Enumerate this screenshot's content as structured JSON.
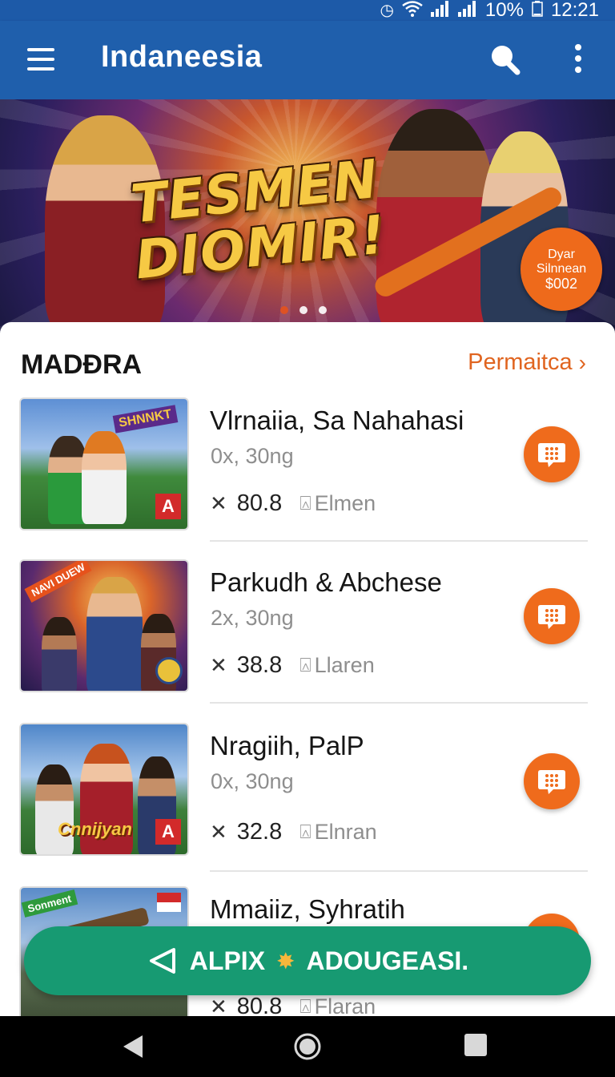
{
  "status_bar": {
    "battery": "10%",
    "time": "12:21"
  },
  "app_bar": {
    "title": "Indaneesia"
  },
  "banner": {
    "headline_line1": "TESMEN",
    "headline_line2": "DIOMIR!",
    "badge_line1": "Dyar",
    "badge_line2": "Silnnean",
    "badge_line3": "$002",
    "page_count": 3,
    "active_page": 1
  },
  "section": {
    "title": "MADÐRA",
    "link_label": "Permaitca"
  },
  "items": [
    {
      "name": "Vlrnaiia, Sa Nahahasi",
      "meta": "0x, 30ng",
      "rating": "80.8",
      "location": "Elmen",
      "thumb_tag": "SHNNKT",
      "thumb_badge": "A"
    },
    {
      "name": "Parkudh & Abchese",
      "meta": "2x, 30ng",
      "rating": "38.8",
      "location": "Llaren",
      "thumb_tag": "NAVI DUEW"
    },
    {
      "name": "Nragiih, PalP",
      "meta": "0x, 30ng",
      "rating": "32.8",
      "location": "Elnran",
      "thumb_tag": "Cnnijyan",
      "thumb_badge": "A"
    },
    {
      "name": "Mmaiiz, Syhratih",
      "meta": "",
      "rating": "80.8",
      "location": "Flaran",
      "thumb_tag": "Sonment"
    }
  ],
  "cta": {
    "label": "ALPIX",
    "label2": "ADOUGEASI."
  },
  "colors": {
    "primary": "#1f5fac",
    "accent": "#ef6b1c",
    "cta": "#179a72"
  },
  "icons": {
    "menu": "menu-icon",
    "search": "search-icon",
    "more": "more-vert-icon",
    "chat": "chat-bubble-icon",
    "send": "send-icon",
    "back": "nav-back-icon",
    "home": "nav-home-icon",
    "recents": "nav-recents-icon"
  }
}
